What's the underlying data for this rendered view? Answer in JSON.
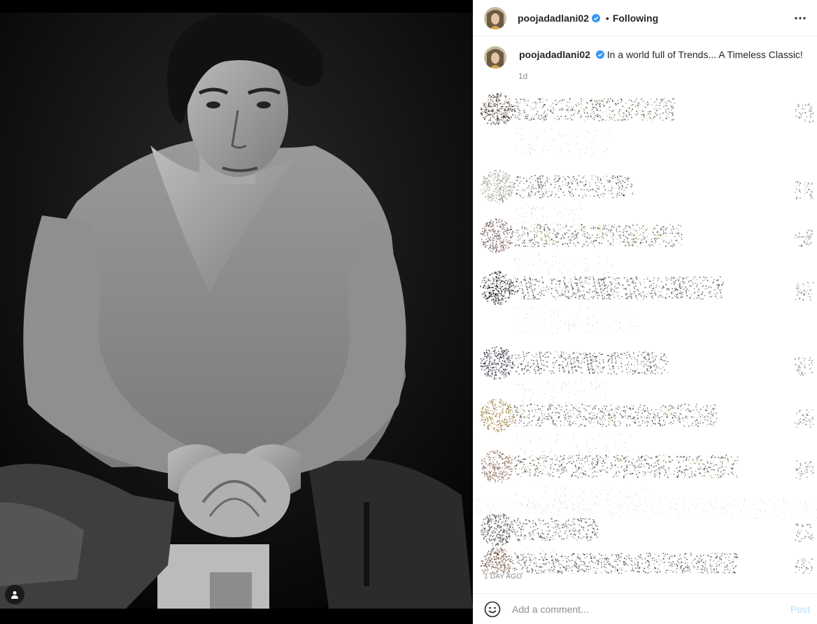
{
  "post": {
    "username": "poojadadlani02",
    "verified": true,
    "follow_separator": "•",
    "follow_status": "Following",
    "caption": "In a world full of Trends... A Timeless Classic!",
    "time_ago": "1d",
    "date": "1 DAY AGO"
  },
  "comment_box": {
    "placeholder": "Add a comment...",
    "post_label": "Post"
  },
  "icons": {
    "more": "more-options-icon",
    "verified": "verified-badge-icon",
    "emoji": "emoji-icon",
    "tag": "user-tag-icon"
  },
  "colors": {
    "verified_blue": "#3897f0",
    "post_button": "#b2dffc",
    "secondary_text": "#8e8e8e",
    "divider": "#efefef"
  }
}
